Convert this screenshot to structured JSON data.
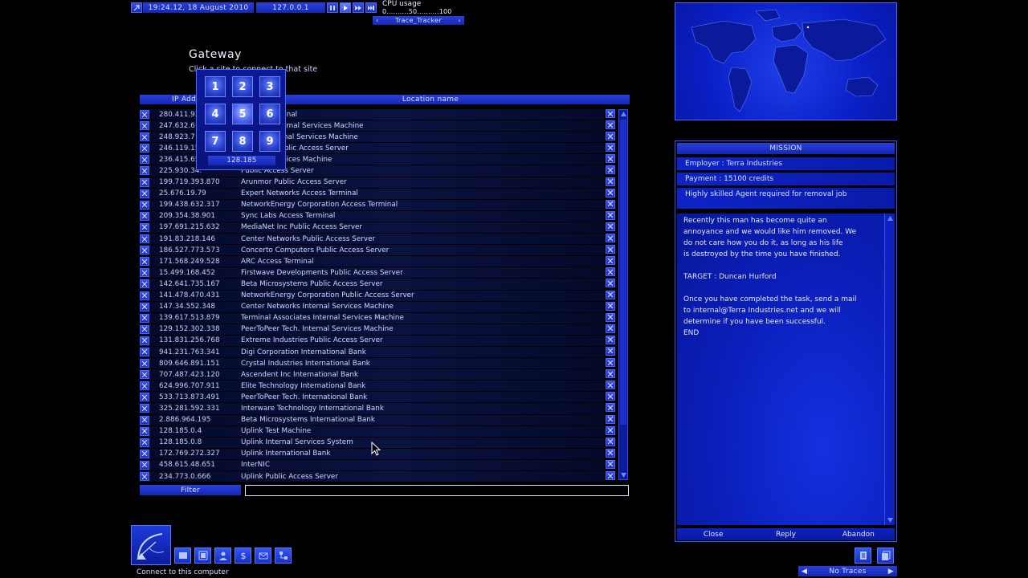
{
  "topbar": {
    "datetime": "19:24.12, 18 August 2010",
    "local_ip": "127.0.0.1",
    "cpu_label": "CPU usage",
    "cpu_scale": "0..........50..........100",
    "tracker_label": "Trace_Tracker"
  },
  "gateway": {
    "title": "Gateway",
    "subtitle": "Click a site to connect to that site"
  },
  "table": {
    "col_ip": "IP Address",
    "col_location": "Location name",
    "rows": [
      {
        "ip": "280.411.93",
        "loc": "Access Terminal"
      },
      {
        "ip": "247.632.6",
        "loc": "systems Internal Services Machine"
      },
      {
        "ip": "248.923.7",
        "loc": "nology Internal Services Machine"
      },
      {
        "ip": "246.119.15",
        "loc": "rporation Public Access Server"
      },
      {
        "ip": "236.415.65",
        "loc": "Internal Services Machine"
      },
      {
        "ip": "225.930.34.",
        "loc": "Public Access Server"
      },
      {
        "ip": "199.719.393.870",
        "loc": "Arunmor Public Access Server"
      },
      {
        "ip": "25.676.19.79",
        "loc": "Expert Networks Access Terminal"
      },
      {
        "ip": "199.438.632.317",
        "loc": "NetworkEnergy Corporation Access Terminal"
      },
      {
        "ip": "209.354.38.901",
        "loc": "Sync Labs Access Terminal"
      },
      {
        "ip": "197.691.215.632",
        "loc": "MediaNet Inc Public Access Server"
      },
      {
        "ip": "191.83.218.146",
        "loc": "Center Networks Public Access Server"
      },
      {
        "ip": "186.527.773.573",
        "loc": "Concerto Computers Public Access Server"
      },
      {
        "ip": "171.568.249.528",
        "loc": "ARC Access Terminal"
      },
      {
        "ip": "15.499.168.452",
        "loc": "Firstwave Developments Public Access Server"
      },
      {
        "ip": "142.641.735.167",
        "loc": "Beta Microsystems Public Access Server"
      },
      {
        "ip": "141.478.470.431",
        "loc": "NetworkEnergy Corporation Public Access Server"
      },
      {
        "ip": "147.34.552.348",
        "loc": "Center Networks Internal Services Machine"
      },
      {
        "ip": "139.617.513.879",
        "loc": "Terminal Associates Internal Services Machine"
      },
      {
        "ip": "129.152.302.338",
        "loc": "PeerToPeer Tech. Internal Services Machine"
      },
      {
        "ip": "131.831.256.768",
        "loc": "Extreme Industries Public Access Server"
      },
      {
        "ip": "941.231.763.341",
        "loc": "Digi Corporation International Bank"
      },
      {
        "ip": "809.646.891.151",
        "loc": "Crystal Industries International Bank"
      },
      {
        "ip": "707.487.423.120",
        "loc": "Ascendent Inc International Bank"
      },
      {
        "ip": "624.996.707.911",
        "loc": "Elite Technology International Bank"
      },
      {
        "ip": "533.713.873.491",
        "loc": "PeerToPeer Tech. International Bank"
      },
      {
        "ip": "325.281.592.331",
        "loc": "Interware Technology International Bank"
      },
      {
        "ip": "2.886.964.195",
        "loc": "Beta Microsystems International Bank"
      },
      {
        "ip": "128.185.0.4",
        "loc": "Uplink Test Machine"
      },
      {
        "ip": "128.185.0.8",
        "loc": "Uplink Internal Services System"
      },
      {
        "ip": "172.769.272.327",
        "loc": "Uplink International Bank"
      },
      {
        "ip": "458.615.48.651",
        "loc": "InterNIC"
      },
      {
        "ip": "234.773.0.666",
        "loc": "Uplink Public Access Server"
      }
    ],
    "filter_label": "Filter",
    "filter_value": ""
  },
  "keypad": {
    "keys": [
      "1",
      "2",
      "3",
      "4",
      "5",
      "6",
      "7",
      "8",
      "9"
    ],
    "highlighted_key": "5",
    "readout": "128.185"
  },
  "mission": {
    "title": "MISSION",
    "employer": "Employer : Terra Industries",
    "payment": "Payment : 15100 credits",
    "summary": "Highly skilled Agent required for removal job",
    "body_1": "Recently this man has become quite an\nannoyance and we would like him removed.  We\ndo not care how you do it, as long as his life\nis destroyed by the time you have finished.",
    "body_2": "TARGET : Duncan Hurford",
    "body_3": "Once you have completed the task, send a mail\nto internal@Terra Industries.net and we will\ndetermine if you have been successful.\nEND",
    "close": "Close",
    "reply": "Reply",
    "abandon": "Abandon"
  },
  "status": {
    "hint": "Connect to this computer",
    "traces": "No Traces"
  },
  "colors": {
    "accent": "#1e34d0",
    "background": "#000000",
    "text": "#c8d0f4"
  }
}
